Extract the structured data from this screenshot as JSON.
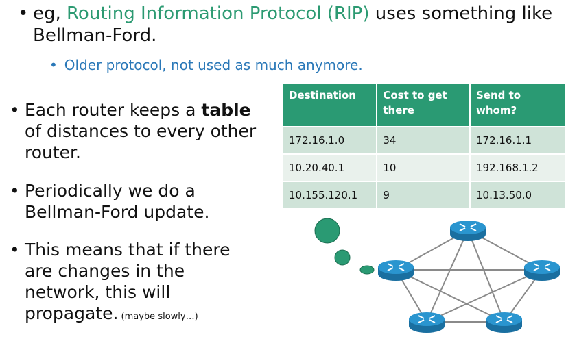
{
  "top_bullet": {
    "prefix": "eg, ",
    "highlight": "Routing Information Protocol (RIP)",
    "suffix": " uses something like Bellman-Ford."
  },
  "sub_bullet": "Older protocol, not used as much anymore.",
  "left_bullets": [
    {
      "pre": "Each router keeps a ",
      "bold": "table",
      "post": " of distances to every other router."
    },
    {
      "text": "Periodically we do a Bellman-Ford update."
    },
    {
      "text": "This means that if there are changes in the network, this will propagate.",
      "small": " (maybe slowly…)"
    }
  ],
  "table": {
    "headers": [
      "Destination",
      "Cost to get there",
      "Send to whom?"
    ],
    "rows": [
      [
        "172.16.1.0",
        "34",
        "172.16.1.1"
      ],
      [
        "10.20.40.1",
        "10",
        "192.168.1.2"
      ],
      [
        "10.155.120.1",
        "9",
        "10.13.50.0"
      ]
    ]
  },
  "colors": {
    "accent_green": "#2c9a72",
    "sub_blue": "#2a78b8",
    "router_blue": "#1e8bc3"
  },
  "icons": [
    "router-icon",
    "thought-bubble-icon"
  ]
}
